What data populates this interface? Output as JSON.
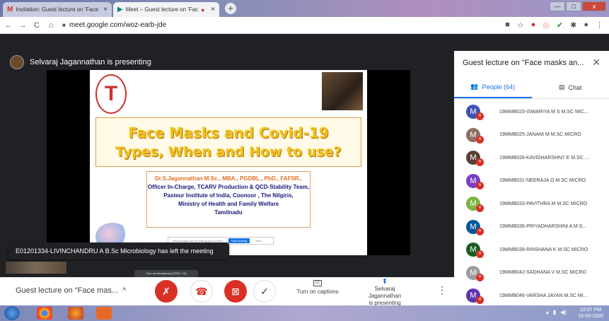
{
  "browser": {
    "tabs": [
      {
        "icon": "gmail-icon",
        "label": "Invitation: Guest lecture on 'Face",
        "close": "×"
      },
      {
        "icon": "meet-icon",
        "label": "Meet – Guest lecture on 'Fac",
        "close": "×"
      }
    ],
    "new_tab": "+",
    "url": "meet.google.com/woz-earb-jde",
    "window_buttons": {
      "minimize": "—",
      "maximize": "□",
      "close": "x"
    }
  },
  "meet": {
    "presenter_label": "Selvaraj Jagannathan is presenting",
    "slide": {
      "title_line1": "Face Masks and Covid-19",
      "title_line2": "Types,  When and How to use?",
      "author_line1": "Dr.S.Jagannathan M.Sc., MBA., PGDBL., PhD., FAFSR.,",
      "author_line2": "Officer In-Charge, TCARV Production & QCD-Stability Team,",
      "author_line3": "Pasteur Institute of India, Coonoor , The Nilgiris,",
      "author_line4": "Ministry of Health and Family Welfare",
      "author_line5": "Tamilnadu",
      "share_text": "meet.google.com is sharing your screen",
      "stop_label": "Stop sharing",
      "hide_label": "Hide"
    },
    "notification": "E01201334-LIVINCHANDRU A B.Sc Microbiology has left the meeting",
    "tooltip": "Turn on microphone (CTRL + D)",
    "controls": {
      "meeting_name": "Guest lecture on \"Face mas...",
      "captions_label": "Turn on captions",
      "captions_icon": "CC",
      "presenting_line1": "Selvaraj Jagannathan",
      "presenting_line2": "is presenting"
    }
  },
  "panel": {
    "title": "Guest lecture on \"Face masks an...",
    "tabs": {
      "people": "People (64)",
      "chat": "Chat"
    },
    "participants": [
      {
        "initial": "M",
        "name": "19MMB023-ISWARIYA M S M.SC MIC...",
        "color": "#3f51b5"
      },
      {
        "initial": "M",
        "name": "19MMB025-JANANI M M.SC MICRO",
        "color": "#8d6e63"
      },
      {
        "initial": "M",
        "name": "19MMB028-KAVIDHARSHNY E M.SC ...",
        "color": "#5d4037"
      },
      {
        "initial": "M",
        "name": "19MMB031-NEERAJA O M.SC MICRO",
        "color": "#7b3fc4"
      },
      {
        "initial": "M",
        "name": "19MMB033-PAVITHRA M M.SC MICRO",
        "color": "#7cb342"
      },
      {
        "initial": "M",
        "name": "19MMB036-PRIYADHARSHINI A M.S...",
        "color": "#00579b"
      },
      {
        "initial": "M",
        "name": "19MMB038-RINSHANA K M.SC MICRO",
        "color": "#1b5e20"
      },
      {
        "initial": "M",
        "name": "19MMB042-SADHANA V M.SC MICRO",
        "color": "#9e9e9e"
      },
      {
        "initial": "M",
        "name": "19MMB046-VARSHA JAYAN M.SC MI...",
        "color": "#5e35b1"
      }
    ]
  },
  "taskbar": {
    "time": "12:07 PM",
    "date": "10-09-2020"
  }
}
